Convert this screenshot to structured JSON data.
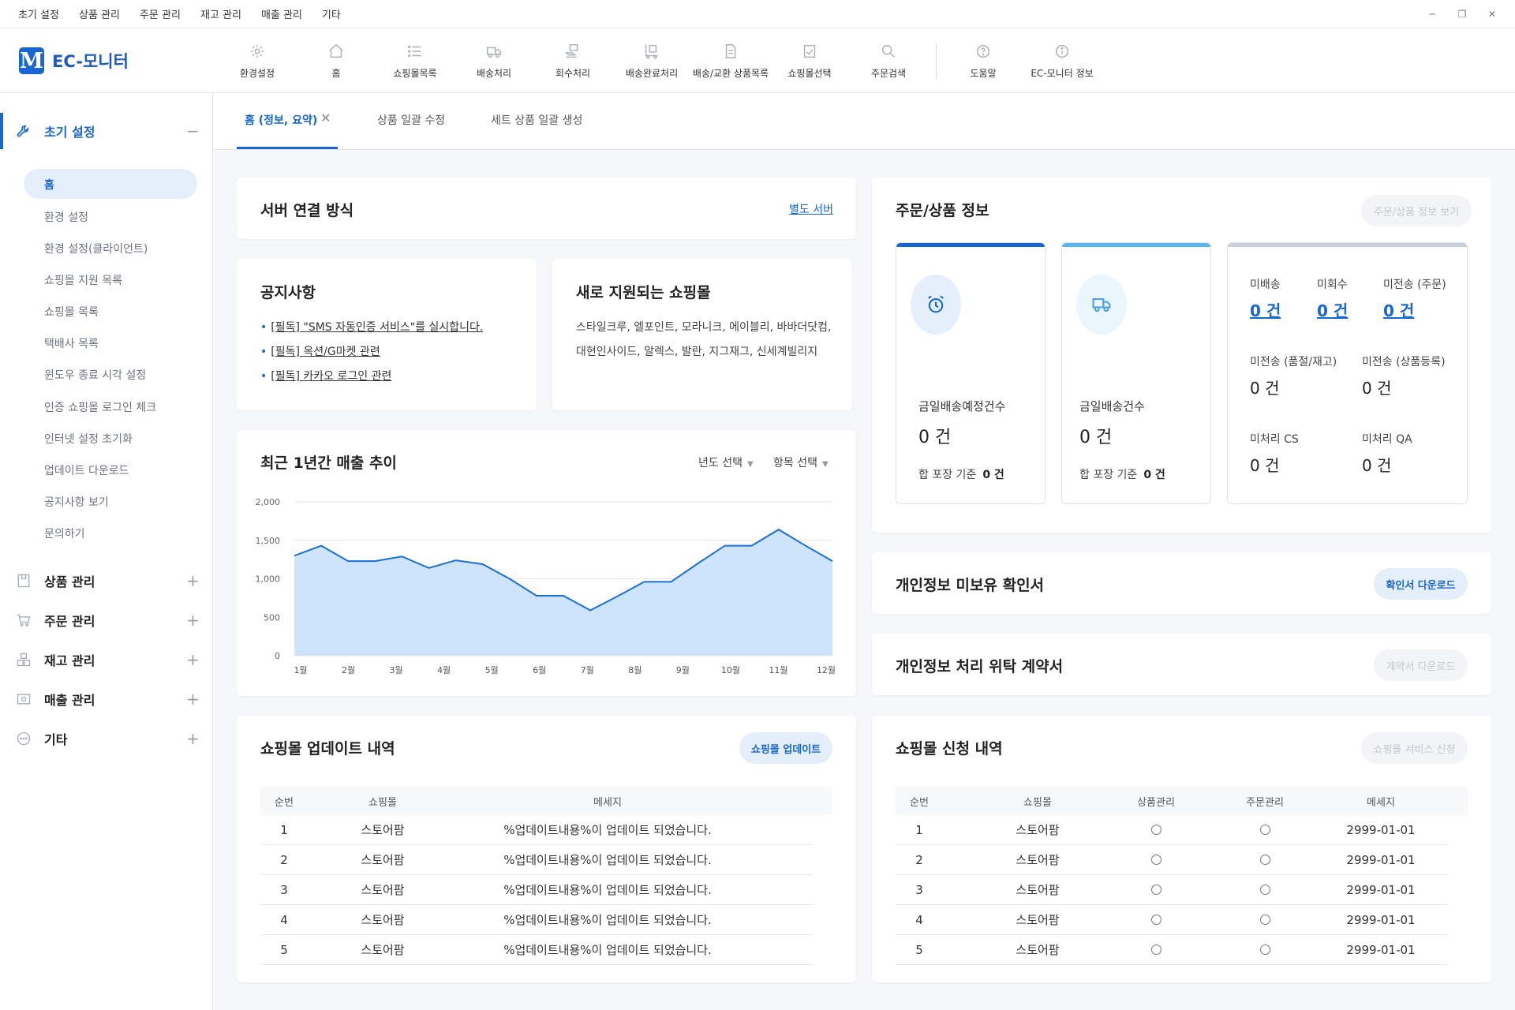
{
  "menubar": {
    "items": [
      "초기 설정",
      "상품 관리",
      "주문 관리",
      "재고 관리",
      "매출 관리",
      "기타"
    ]
  },
  "window_controls": {
    "minimize": "─",
    "maximize": "❐",
    "close": "✕"
  },
  "app": {
    "logo_letter": "M",
    "name": "EC-모니터",
    "accent": "#1766d1"
  },
  "toolbar": {
    "items": [
      {
        "label": "환경설정",
        "icon": "gear-icon"
      },
      {
        "label": "홈",
        "icon": "home-icon"
      },
      {
        "label": "쇼핑몰목록",
        "icon": "list-icon"
      },
      {
        "label": "배송처리",
        "icon": "truck-icon"
      },
      {
        "label": "회수처리",
        "icon": "return-icon"
      },
      {
        "label": "배송완료처리",
        "icon": "delivered-icon"
      },
      {
        "label": "배송/교환 상품목록",
        "icon": "document-icon"
      },
      {
        "label": "쇼핑몰선택",
        "icon": "checklist-icon"
      },
      {
        "label": "주문검색",
        "icon": "search-icon"
      },
      {
        "label": "도움말",
        "icon": "help-icon"
      },
      {
        "label": "EC-모니터 정보",
        "icon": "info-icon"
      }
    ]
  },
  "sidebar": {
    "active_section": {
      "label": "초기 설정",
      "toggle": "−"
    },
    "sub_items": [
      "홈",
      "환경 설정",
      "환경 설정(클라이언트)",
      "쇼핑몰 지원 목록",
      "쇼핑몰 목록",
      "택배사 목록",
      "윈도우 종료 시각 설정",
      "인증 쇼핑몰 로그인 체크",
      "인터넷 설정 초기화",
      "업데이트 다운로드",
      "공지사항 보기",
      "문의하기"
    ],
    "sections": [
      {
        "label": "상품 관리",
        "toggle": "+",
        "icon": "box-icon"
      },
      {
        "label": "주문 관리",
        "toggle": "+",
        "icon": "cart-icon"
      },
      {
        "label": "재고 관리",
        "toggle": "+",
        "icon": "inventory-icon"
      },
      {
        "label": "매출 관리",
        "toggle": "+",
        "icon": "sales-icon"
      },
      {
        "label": "기타",
        "toggle": "+",
        "icon": "more-icon"
      }
    ]
  },
  "tabs": [
    {
      "label": "홈 (정보, 요약)",
      "active": true,
      "close": "✕"
    },
    {
      "label": "상품 일괄 수정"
    },
    {
      "label": "세트 상품 일괄 생성"
    }
  ],
  "server": {
    "title": "서버 연결 방식",
    "link": "별도 서버"
  },
  "notice": {
    "title": "공지사항",
    "items": [
      "[필독] \"SMS 자동인증 서비스\"를 실시합니다.",
      "[필독] 옥션/G마켓 관련",
      "[필독] 카카오 로그인 관련"
    ]
  },
  "new_malls": {
    "title": "새로 지원되는 쇼핑몰",
    "text": "스타일크루, 엘포인트, 모라니크, 에이블리, 바바더닷컴, 대현인사이드, 알렉스, 발란, 지그재그, 신세계빌리지"
  },
  "sales_chart": {
    "title": "최근 1년간 매출 추이",
    "year_select": "년도 선택",
    "item_select": "항목 선택"
  },
  "chart_data": {
    "type": "area",
    "title": "최근 1년간 매출 추이",
    "categories": [
      "1월",
      "2월",
      "3월",
      "4월",
      "5월",
      "6월",
      "7월",
      "8월",
      "9월",
      "10월",
      "11월",
      "12월"
    ],
    "x_points": [
      0,
      0.5,
      1,
      1.5,
      2,
      2.5,
      3,
      3.5,
      4,
      4.5,
      5,
      5.5,
      6,
      6.5,
      7,
      7.5,
      8,
      8.5,
      9,
      9.5,
      10,
      10.5,
      11,
      11.5
    ],
    "series": [
      {
        "values": [
          1300,
          1430,
          1230,
          1230,
          1290,
          1140,
          1240,
          1190,
          1000,
          780,
          780,
          590,
          770,
          960,
          960,
          1200,
          1430,
          1430,
          1640,
          1430,
          1230
        ]
      }
    ],
    "ylim": [
      0,
      2000
    ],
    "yticks": [
      "2,000",
      "1,500",
      "1,000",
      "500",
      "0"
    ],
    "grid": true,
    "fill_color": "#cde4fc",
    "line_color": "#1a6ed8"
  },
  "order_info": {
    "title": "주문/상품 정보",
    "button": "주문/상품 정보 보기",
    "box1": {
      "label": "금일배송예정건수",
      "value": "0 건",
      "sub_label": "합 포장 기준",
      "sub_value": "0 건",
      "color": "#1766d1",
      "icon": "alarm-clock-icon"
    },
    "box2": {
      "label": "금일배송건수",
      "value": "0 건",
      "sub_label": "합 포장 기준",
      "sub_value": "0 건",
      "color": "#5bb6ef",
      "icon": "truck-icon"
    },
    "box3": {
      "color": "#c9d0d9",
      "items": [
        {
          "label": "미배송",
          "value": "0 건"
        },
        {
          "label": "미회수",
          "value": "0 건"
        },
        {
          "label": "미전송 (주문)",
          "value": "0 건"
        },
        {
          "label": "미전송 (품절/재고)",
          "value": "0 건"
        },
        {
          "label": "미전송 (상품등록)",
          "value": "0 건"
        },
        {
          "label": "미처리 CS",
          "value": "0 건"
        },
        {
          "label": "미처리 QA",
          "value": "0 건"
        }
      ]
    }
  },
  "privacy1": {
    "title": "개인정보 미보유 확인서",
    "button": "확인서 다운로드"
  },
  "privacy2": {
    "title": "개인정보 처리 위탁 계약서",
    "button": "계약서 다운로드"
  },
  "mall_update": {
    "title": "쇼핑몰 업데이트 내역",
    "button": "쇼핑몰 업데이트",
    "columns": [
      "순번",
      "쇼핑몰",
      "메세지"
    ],
    "rows": [
      [
        "1",
        "스토어팜",
        "%업데이트내용%이 업데이트 되었습니다."
      ],
      [
        "2",
        "스토어팜",
        "%업데이트내용%이 업데이트 되었습니다."
      ],
      [
        "3",
        "스토어팜",
        "%업데이트내용%이 업데이트 되었습니다."
      ],
      [
        "4",
        "스토어팜",
        "%업데이트내용%이 업데이트 되었습니다."
      ],
      [
        "5",
        "스토어팜",
        "%업데이트내용%이 업데이트 되었습니다."
      ]
    ]
  },
  "mall_apply": {
    "title": "쇼핑몰 신청 내역",
    "button": "쇼핑몰 서비스 신청",
    "columns": [
      "순번",
      "쇼핑몰",
      "상품관리",
      "주문관리",
      "메세지"
    ],
    "rows": [
      [
        "1",
        "스토어팜",
        "2999-01-01"
      ],
      [
        "2",
        "스토어팜",
        "2999-01-01"
      ],
      [
        "3",
        "스토어팜",
        "2999-01-01"
      ],
      [
        "4",
        "스토어팜",
        "2999-01-01"
      ],
      [
        "5",
        "스토어팜",
        "2999-01-01"
      ]
    ]
  }
}
